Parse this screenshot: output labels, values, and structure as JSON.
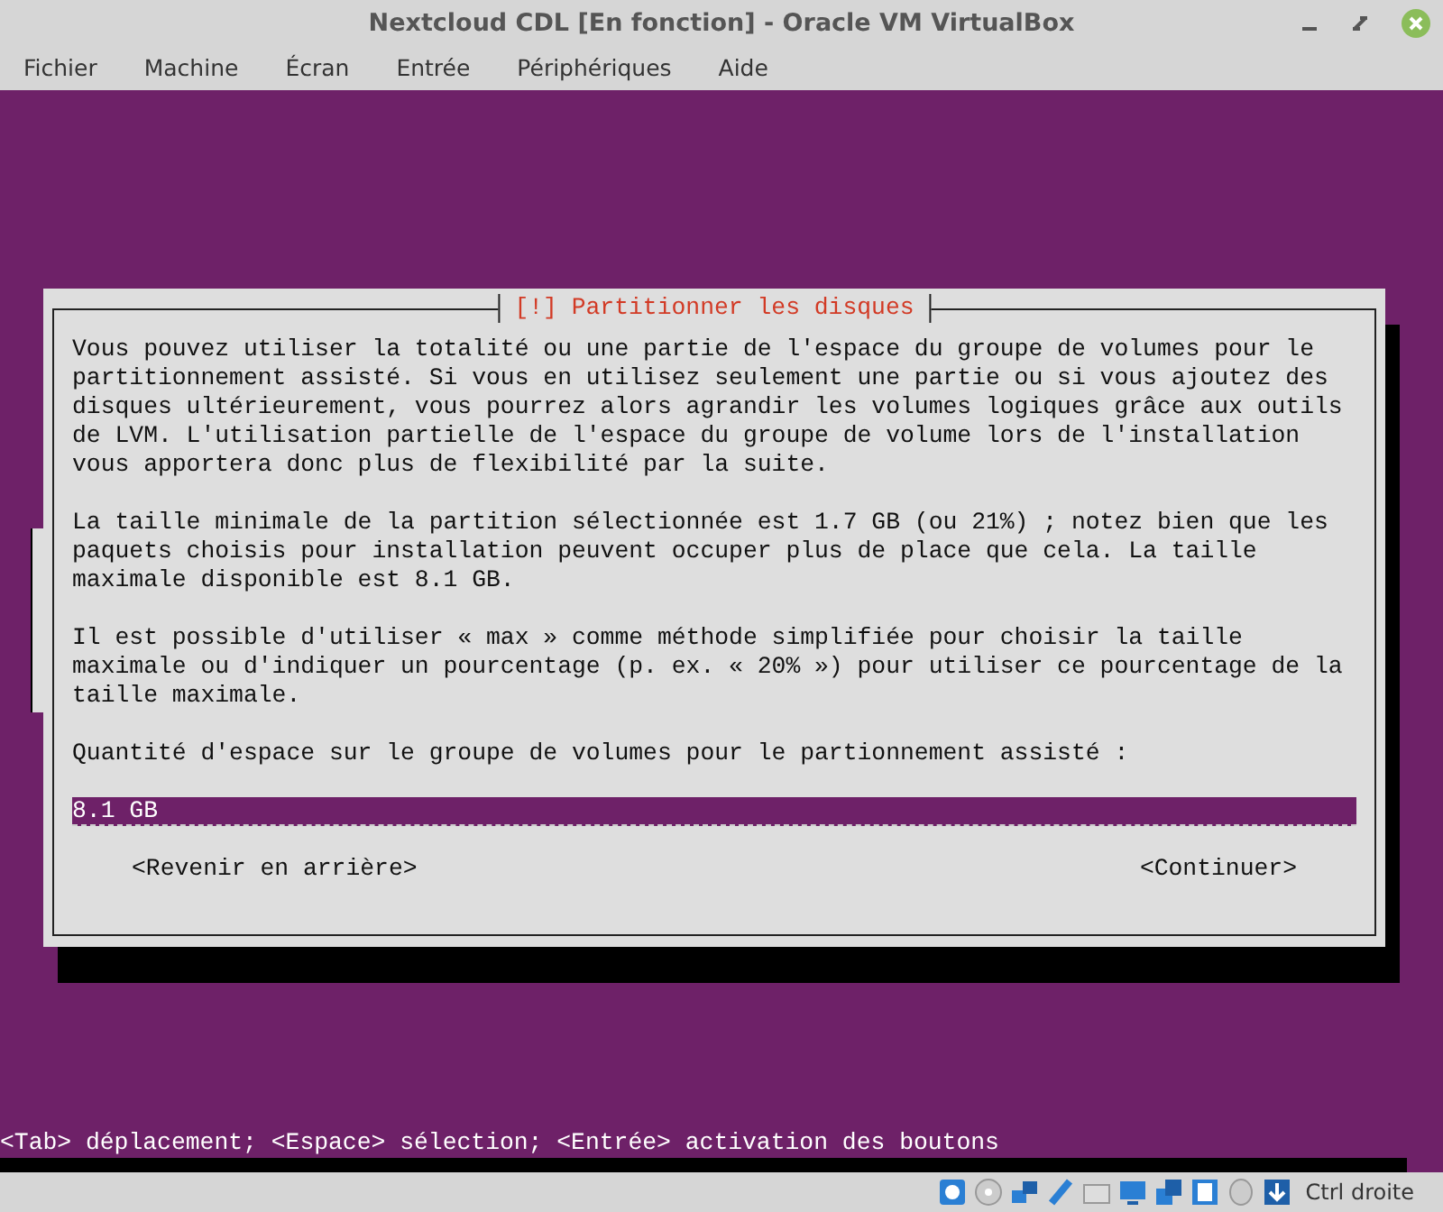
{
  "window": {
    "title": "Nextcloud CDL [En fonction] - Oracle VM VirtualBox"
  },
  "menu": [
    "Fichier",
    "Machine",
    "Écran",
    "Entrée",
    "Périphériques",
    "Aide"
  ],
  "dialog": {
    "title": "[!] Partitionner les disques",
    "paragraphs": [
      "Vous pouvez utiliser la totalité ou une partie de l'espace du groupe de volumes pour le\npartitionnement assisté. Si vous en utilisez seulement une partie ou si vous ajoutez des\ndisques ultérieurement, vous pourrez alors agrandir les volumes logiques grâce aux outils\nde LVM. L'utilisation partielle de l'espace du groupe de volume lors de l'installation\nvous apportera donc plus de flexibilité par la suite.",
      "La taille minimale de la partition sélectionnée est 1.7 GB (ou 21%) ; notez bien que les\npaquets choisis pour installation peuvent occuper plus de place que cela. La taille\nmaximale disponible est 8.1 GB.",
      "Il est possible d'utiliser « max » comme méthode simplifiée pour choisir la taille\nmaximale ou d'indiquer un pourcentage (p. ex. « 20% ») pour utiliser ce pourcentage de la\ntaille maximale."
    ],
    "prompt": "Quantité d'espace sur le groupe de volumes pour le partionnement assisté :",
    "value": "8.1 GB",
    "buttons": [
      "<Revenir en arrière>",
      "<Continuer>"
    ]
  },
  "hint": "<Tab> déplacement; <Espace> sélection; <Entrée> activation des boutons",
  "status_bar": {
    "host_key": "Ctrl droite"
  }
}
